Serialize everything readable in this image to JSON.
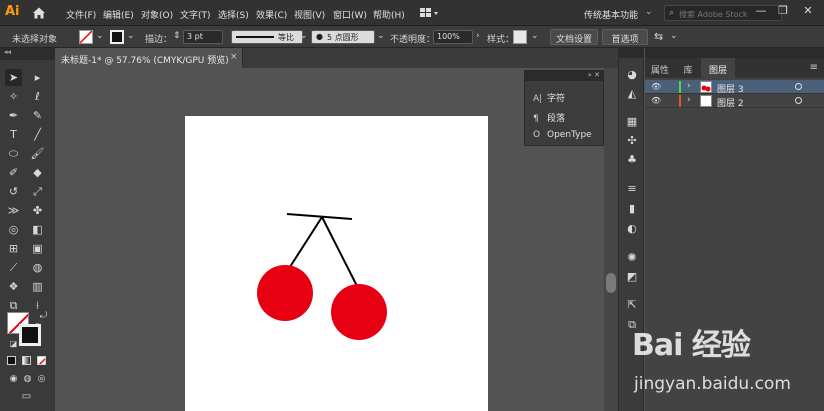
{
  "app": {
    "logo": "Ai"
  },
  "menu": [
    "文件(F)",
    "编辑(E)",
    "对象(O)",
    "文字(T)",
    "选择(S)",
    "效果(C)",
    "视图(V)",
    "窗口(W)",
    "帮助(H)"
  ],
  "workspace": "传统基本功能",
  "search": {
    "placeholder": "搜索 Adobe Stock"
  },
  "window_controls": {
    "minimize": "—",
    "restore": "❐",
    "close": "✕"
  },
  "control_bar": {
    "selection_status": "未选择对象",
    "stroke_label": "描边：",
    "stroke_weight": "3 pt",
    "profile_label": "等比",
    "brush_label": "5 点圆形",
    "opacity_label": "不透明度：",
    "opacity_value": "100%",
    "style_label": "样式：",
    "doc_setup_button": "文档设置",
    "preferences_button": "首选项"
  },
  "document_tab": {
    "title": "未标题-1* @ 57.76% (CMYK/GPU 预览)",
    "close": "×"
  },
  "type_panel": {
    "items": [
      {
        "icon": "A|",
        "label": "字符"
      },
      {
        "icon": "¶",
        "label": "段落"
      },
      {
        "icon": "O",
        "label": "OpenType"
      }
    ]
  },
  "layers_panel": {
    "tabs": [
      "属性",
      "库",
      "图层"
    ],
    "active_tab": "图层",
    "layers": [
      {
        "name": "图层 3",
        "color": "#4ed84e",
        "selected": true
      },
      {
        "name": "图层 2",
        "color": "#e0552a",
        "selected": false
      }
    ]
  },
  "artwork": {
    "cherry_color": "#e60012",
    "stem_color": "#000000"
  },
  "watermark": {
    "logo": "Bai 经验",
    "url": "jingyan.baidu.com"
  }
}
